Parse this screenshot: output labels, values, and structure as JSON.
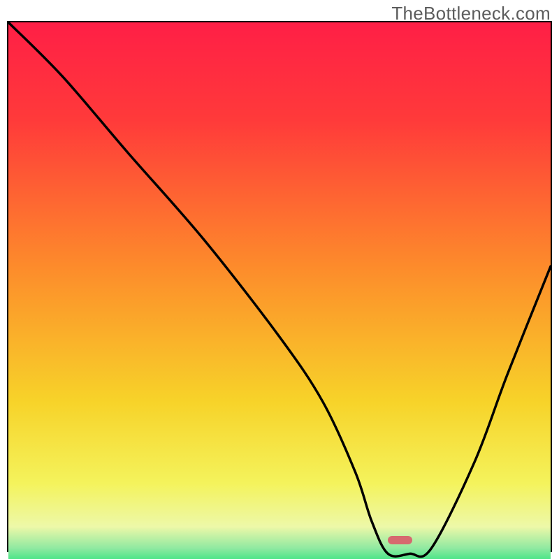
{
  "watermark": "TheBottleneck.com",
  "colors": {
    "top": "#ff1f46",
    "upper_mid": "#fd8b2b",
    "mid": "#f7d329",
    "lower_mid": "#f4f35c",
    "pale": "#edf8a8",
    "green": "#2be37c",
    "curve": "#000000",
    "border": "#000000",
    "marker": "#d6696f"
  },
  "chart_data": {
    "type": "line",
    "title": "",
    "xlabel": "",
    "ylabel": "",
    "xlim": [
      0,
      100
    ],
    "ylim": [
      0,
      100
    ],
    "note": "Bottleneck-style V-curve over vertical red→green gradient",
    "x": [
      0,
      10,
      22,
      36,
      50,
      58,
      64,
      67,
      70,
      74,
      78,
      86,
      92,
      100
    ],
    "y": [
      100,
      90,
      76,
      60,
      42,
      30,
      17,
      8,
      2,
      2,
      3,
      19,
      35,
      55
    ],
    "marker": {
      "x_start": 70,
      "x_end": 74.5,
      "y": 2
    },
    "gradient_stops": [
      {
        "pct": 0,
        "color": "#ff1f46"
      },
      {
        "pct": 18,
        "color": "#ff3a3a"
      },
      {
        "pct": 45,
        "color": "#fd8b2b"
      },
      {
        "pct": 70,
        "color": "#f7d329"
      },
      {
        "pct": 85,
        "color": "#f4f35c"
      },
      {
        "pct": 93,
        "color": "#edf8a8"
      },
      {
        "pct": 97,
        "color": "#8fe9a1"
      },
      {
        "pct": 100,
        "color": "#2be37c"
      }
    ]
  }
}
